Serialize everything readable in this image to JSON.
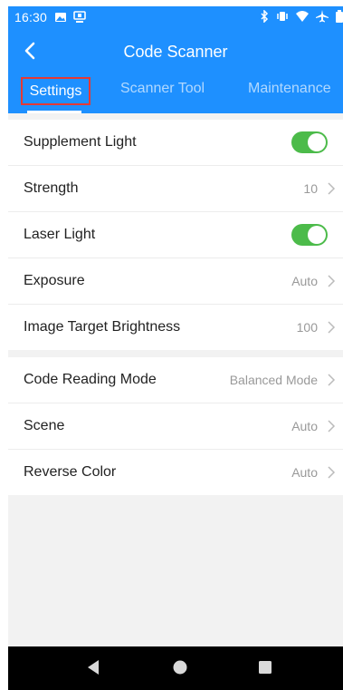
{
  "status_bar": {
    "time": "16:30"
  },
  "app_bar": {
    "title": "Code Scanner"
  },
  "tabs": [
    {
      "label": "Settings",
      "active": true
    },
    {
      "label": "Scanner Tool",
      "active": false
    },
    {
      "label": "Maintenance",
      "active": false
    }
  ],
  "settings_group_1": [
    {
      "label": "Supplement Light",
      "toggle": true
    },
    {
      "label": "Strength",
      "value": "10"
    },
    {
      "label": "Laser Light",
      "toggle": true
    },
    {
      "label": "Exposure",
      "value": "Auto"
    },
    {
      "label": "Image Target Brightness",
      "value": "100"
    }
  ],
  "settings_group_2": [
    {
      "label": "Code Reading Mode",
      "value": "Balanced Mode"
    },
    {
      "label": "Scene",
      "value": "Auto"
    },
    {
      "label": "Reverse Color",
      "value": "Auto"
    }
  ],
  "colors": {
    "primary": "#1e90ff",
    "toggle_on": "#4cbb4a",
    "highlight_border": "#e53935"
  },
  "icons": {
    "status_left": [
      "image-icon",
      "monitor-icon"
    ],
    "status_right": [
      "bluetooth-icon",
      "vibrate-icon",
      "wifi-icon",
      "airplane-icon",
      "battery-icon"
    ],
    "nav": [
      "nav-back-icon",
      "nav-home-icon",
      "nav-recent-icon"
    ]
  }
}
